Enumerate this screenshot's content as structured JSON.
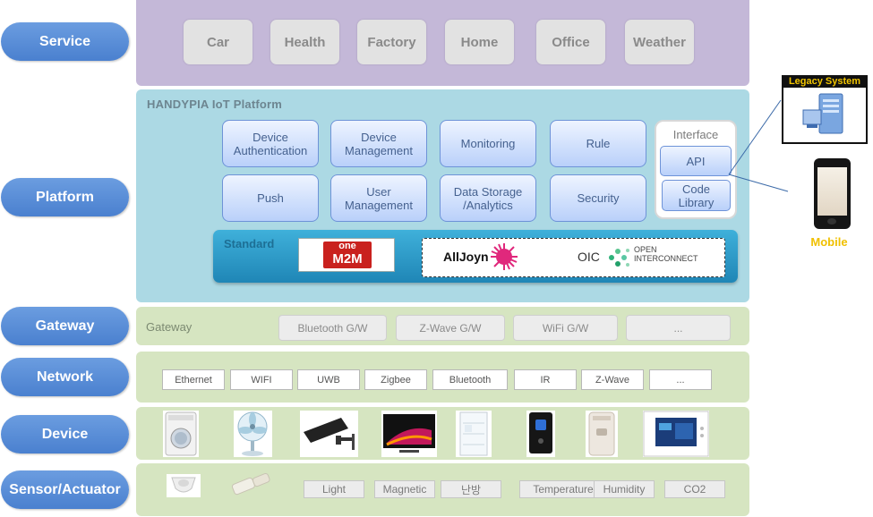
{
  "layers": [
    "Service",
    "Platform",
    "Gateway",
    "Network",
    "Device",
    "Sensor/Actuator"
  ],
  "service": {
    "items": [
      "Car",
      "Health",
      "Factory",
      "Home",
      "Office",
      "Weather"
    ]
  },
  "platform": {
    "title": "HANDYPIA  IoT Platform",
    "modules": [
      "Device\nAuthentication",
      "Device\nManagement",
      "Monitoring",
      "Rule",
      "Push",
      "User\nManagement",
      "Data Storage\n/Analytics",
      "Security"
    ],
    "interface": {
      "title": "Interface",
      "api": "API",
      "code_library": "Code\nLibrary"
    },
    "standard": {
      "label": "Standard",
      "onem2m_top": "one",
      "onem2m_bottom": "M2M",
      "alljoyn": "AllJoyn",
      "oic": "OIC",
      "open_interconnect": "OPEN\nINTERCONNECT"
    }
  },
  "gateway": {
    "label": "Gateway",
    "items": [
      "Bluetooth G/W",
      "Z-Wave G/W",
      "WiFi G/W",
      "..."
    ]
  },
  "network": {
    "items": [
      "Ethernet",
      "WIFI",
      "UWB",
      "Zigbee",
      "Bluetooth",
      "IR",
      "Z-Wave",
      "..."
    ]
  },
  "device": {
    "items": [
      "washing-machine",
      "electric-fan",
      "cctv-camera",
      "television",
      "refrigerator",
      "smart-panel",
      "water-heater",
      "wall-display"
    ]
  },
  "sensor": {
    "items": [
      "Light",
      "Magnetic",
      "난방",
      "Temperature",
      "Humidity",
      "CO2"
    ]
  },
  "external": {
    "legacy_system": "Legacy System",
    "mobile": "Mobile"
  },
  "colors": {
    "pill": "#5b8fd8",
    "service_band": "#c3b6d6",
    "platform_band": "#acd9e4",
    "lower_band": "#d6e5c1",
    "standard_bar": "#2f9bc9",
    "mobile_label": "#f0c000"
  }
}
